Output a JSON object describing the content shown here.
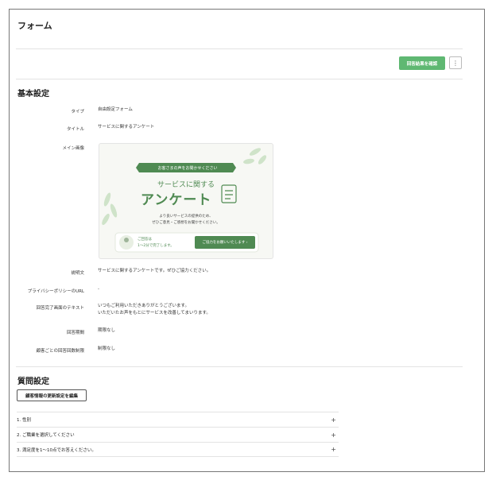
{
  "page": {
    "title": "フォーム"
  },
  "toolbar": {
    "confirm_label": "回答結果を確認",
    "more_label": "⋮"
  },
  "basic": {
    "title": "基本設定",
    "fields": [
      {
        "label": "タイプ",
        "value": "自由設定フォーム"
      },
      {
        "label": "タイトル",
        "value": "サービスに関するアンケート"
      },
      {
        "label": "メイン画像",
        "value": ""
      },
      {
        "label": "説明文",
        "value": "サービスに関するアンケートです。ぜひご協力ください。"
      },
      {
        "label": "プライバシーポリシーのURL",
        "value": "-"
      },
      {
        "label": "回答完了画面のテキスト",
        "value": "いつもご利用いただきありがとうございます。",
        "value2": "いただいたお声をもとにサービスを改善してまいります。"
      },
      {
        "label": "回答期間",
        "value": "期限なし"
      },
      {
        "label": "顧客ごとの回答回数制限",
        "value": "制限なし"
      }
    ]
  },
  "banner": {
    "ribbon": "お客さまの声をお聞かせください",
    "heading1": "サービスに関する",
    "heading2": "アンケート",
    "sub1": "より良いサービスの提供のため、",
    "sub2": "ぜひご意見・ご感想をお聞かせください。",
    "time1": "ご回答は",
    "time2": "1〜2分で完了します。",
    "cta": "ご協力をお願いいたします ›",
    "accent": "#4f8a52"
  },
  "questions": {
    "title": "質問設定",
    "edit_label": "顧客情報の更新設定を編集",
    "items": [
      {
        "label": "1. 性別"
      },
      {
        "label": "2. ご職業を選択してください"
      },
      {
        "label": "3. 満足度を1〜10点でお答えください。"
      }
    ]
  },
  "colors": {
    "primary": "#5fb872",
    "banner_green": "#4f8a52"
  }
}
